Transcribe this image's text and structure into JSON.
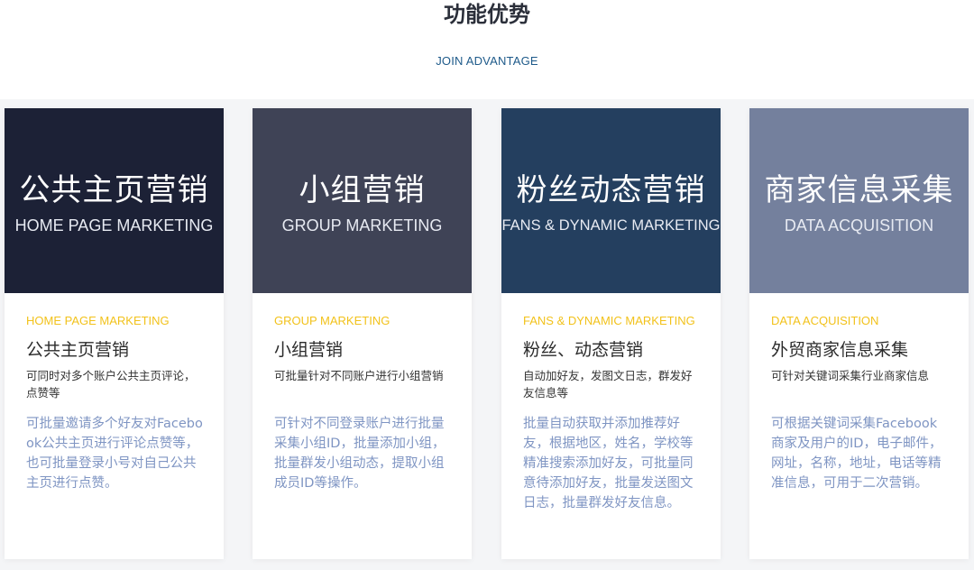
{
  "header": {
    "title": "功能优势",
    "subtitle": "JOIN ADVANTAGE"
  },
  "cards": [
    {
      "banner_cn": "公共主页营销",
      "banner_en": "HOME PAGE MARKETING",
      "banner_color": "#1c2136",
      "label_en": "HOME PAGE MARKETING",
      "title": "公共主页营销",
      "desc": "可同时对多个账户公共主页评论，点赞等",
      "detail": "可批量邀请多个好友对Facebook公共主页进行评论点赞等，也可批量登录小号对自己公共主页进行点赞。"
    },
    {
      "banner_cn": "小组营销",
      "banner_en": "GROUP MARKETING",
      "banner_color": "#3f4356",
      "label_en": "GROUP MARKETING",
      "title": "小组营销",
      "desc": "可批量针对不同账户进行小组营销",
      "detail": "可针对不同登录账户进行批量采集小组ID，批量添加小组，批量群发小组动态，提取小组成员ID等操作。"
    },
    {
      "banner_cn": "粉丝动态营销",
      "banner_en": "FANS & DYNAMIC MARKETING",
      "banner_color": "#243f5f",
      "label_en": "FANS & DYNAMIC MARKETING",
      "title": "粉丝、动态营销",
      "desc": "自动加好友，发图文日志，群发好友信息等",
      "detail": "批量自动获取并添加推荐好友，根据地区，姓名，学校等精准搜索添加好友，可批量同意待添加好友，批量发送图文日志，批量群发好友信息。"
    },
    {
      "banner_cn": "商家信息采集",
      "banner_en": "DATA ACQUISITION",
      "banner_color": "#74809d",
      "label_en": "DATA ACQUISITION",
      "title": "外贸商家信息采集",
      "desc": "可针对关键词采集行业商家信息",
      "detail": "可根据关键词采集Facebook商家及用户的ID，电子邮件，网址，名称，地址，电话等精准信息，可用于二次营销。"
    }
  ]
}
